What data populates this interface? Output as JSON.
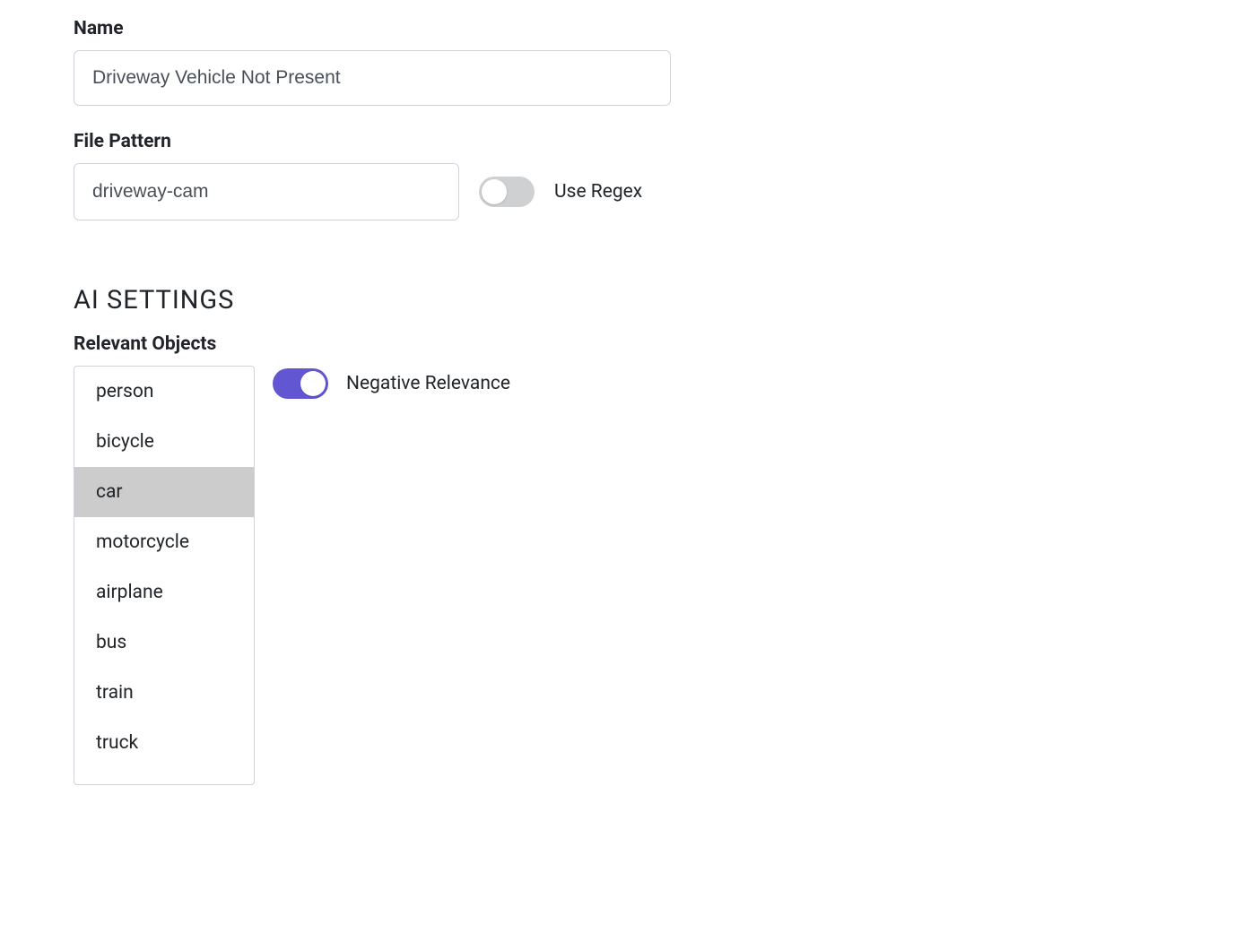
{
  "form": {
    "name_label": "Name",
    "name_value": "Driveway Vehicle Not Present",
    "file_pattern_label": "File Pattern",
    "file_pattern_value": "driveway-cam",
    "use_regex_label": "Use Regex",
    "use_regex_on": false
  },
  "ai_settings": {
    "heading": "AI SETTINGS",
    "relevant_objects_label": "Relevant Objects",
    "objects": [
      {
        "label": "person",
        "selected": false
      },
      {
        "label": "bicycle",
        "selected": false
      },
      {
        "label": "car",
        "selected": true
      },
      {
        "label": "motorcycle",
        "selected": false
      },
      {
        "label": "airplane",
        "selected": false
      },
      {
        "label": "bus",
        "selected": false
      },
      {
        "label": "train",
        "selected": false
      },
      {
        "label": "truck",
        "selected": false
      }
    ],
    "negative_relevance_label": "Negative Relevance",
    "negative_relevance_on": true
  }
}
